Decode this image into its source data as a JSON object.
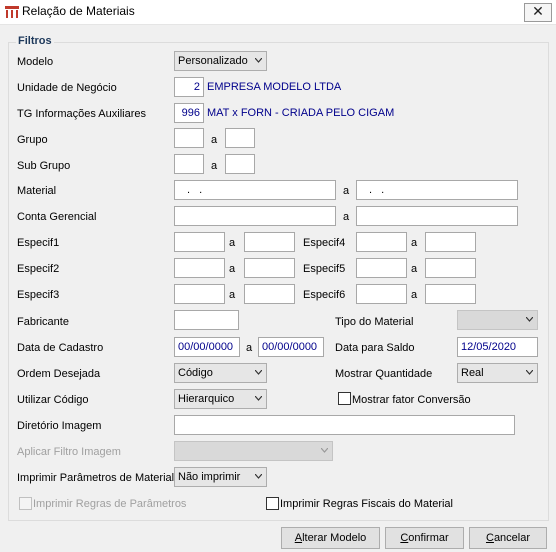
{
  "window": {
    "title": "Relação de Materiais",
    "close_glyph": "✕"
  },
  "groupbox": {
    "title": "Filtros"
  },
  "fields": {
    "modelo": {
      "label": "Modelo",
      "value": "Personalizado"
    },
    "unidade": {
      "label": "Unidade de Negócio",
      "code": "2",
      "desc": "EMPRESA MODELO LTDA"
    },
    "tg": {
      "label": "TG Informações  Auxiliares",
      "code": "996",
      "desc": "MAT x FORN - CRIADA PELO CIGAM"
    },
    "grupo": {
      "label": "Grupo",
      "sep": "a"
    },
    "subgrupo": {
      "label": "Sub Grupo",
      "sep": "a"
    },
    "material": {
      "label": "Material",
      "from": ".  .",
      "to": ".  .",
      "sep": "a"
    },
    "conta": {
      "label": "Conta Gerencial",
      "sep": "a"
    },
    "especif1": {
      "label": "Especif1",
      "sep": "a"
    },
    "especif2": {
      "label": "Especif2",
      "sep": "a"
    },
    "especif3": {
      "label": "Especif3",
      "sep": "a"
    },
    "especif4": {
      "label": "Especif4",
      "sep": "a"
    },
    "especif5": {
      "label": "Especif5",
      "sep": "a"
    },
    "especif6": {
      "label": "Especif6",
      "sep": "a"
    },
    "fabricante": {
      "label": "Fabricante"
    },
    "tipo_material": {
      "label": "Tipo do Material",
      "value": ""
    },
    "data_cadastro": {
      "label": "Data de Cadastro",
      "from": "00/00/0000",
      "to": "00/00/0000",
      "sep": "a"
    },
    "data_saldo": {
      "label": "Data para Saldo",
      "value": "12/05/2020"
    },
    "ordem": {
      "label": "Ordem Desejada",
      "value": "Código"
    },
    "mostrar_qtd": {
      "label": "Mostrar Quantidade",
      "value": "Real"
    },
    "utilizar_codigo": {
      "label": "Utilizar Código",
      "value": "Hierarquico"
    },
    "fator_conversao": {
      "label": "Mostrar fator Conversão",
      "checked": false
    },
    "diretorio": {
      "label": "Diretório Imagem",
      "value": ""
    },
    "filtro_imagem": {
      "label": "Aplicar Filtro Imagem",
      "value": ""
    },
    "imprimir_param": {
      "label": "Imprimir Parâmetros de Material",
      "value": "Não imprimir"
    },
    "regras_param": {
      "label": "Imprimir Regras de Parâmetros",
      "checked": false
    },
    "regras_fiscais": {
      "label": "Imprimir Regras Fiscais do Material",
      "checked": false
    }
  },
  "buttons": {
    "alterar": {
      "pre": "",
      "key": "A",
      "post": "lterar Modelo"
    },
    "confirmar": {
      "pre": "",
      "key": "C",
      "post": "onfirmar"
    },
    "cancelar": {
      "pre": "",
      "key": "C",
      "post": "ancelar"
    }
  },
  "icons": {
    "app": "app-logo-icon",
    "dropdown": "chevron-down-icon",
    "close": "close-icon"
  },
  "colors": {
    "accent_text": "#00008b",
    "group_title": "#1e395b",
    "app_icon": "#c0392b"
  }
}
